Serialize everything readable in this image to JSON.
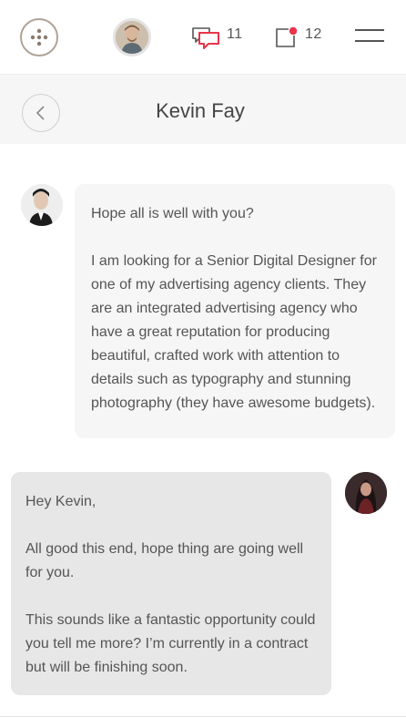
{
  "header": {
    "chat_count": "11",
    "notification_count": "12",
    "accent_color": "#e8344a"
  },
  "conversation": {
    "contact_name": "Kevin Fay"
  },
  "messages": [
    {
      "sender": "Kevin Fay",
      "direction": "incoming",
      "paragraphs": [
        "Hope all is well with you?",
        "I am looking for a Senior Digital Designer for one of my advertising agency clients.   They are an integrated advertising agency who have a great reputation for producing beautiful, crafted work with attention to details such as typography and stunning photography (they have awesome budgets)."
      ]
    },
    {
      "direction": "outgoing",
      "paragraphs": [
        "Hey Kevin,",
        "All good this end, hope thing are going well for you.",
        "This sounds like a fantastic opportunity could you tell me more? I’m currently in a contract but will be finishing soon."
      ]
    }
  ]
}
